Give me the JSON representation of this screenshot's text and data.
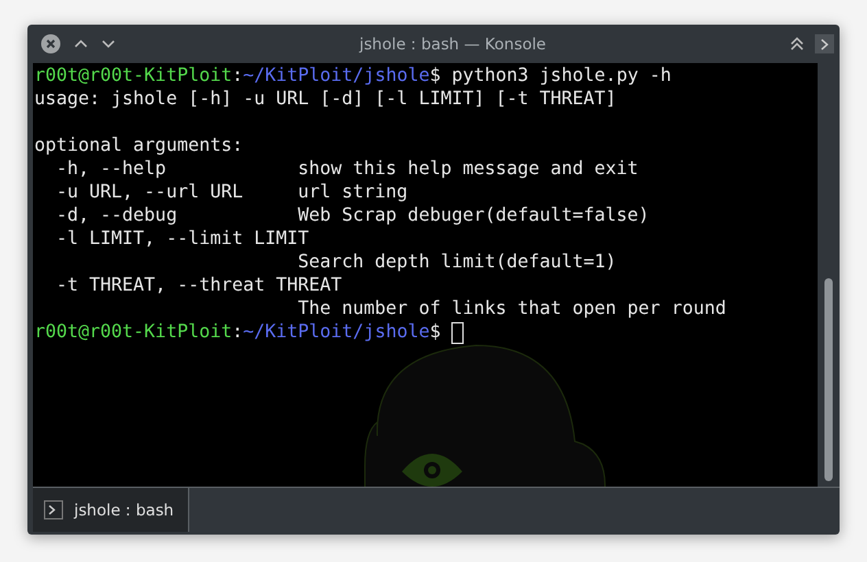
{
  "window": {
    "title": "jshole : bash — Konsole"
  },
  "terminal": {
    "lines": [
      {
        "kind": "prompt",
        "segments": [
          {
            "kind": "user",
            "text": "r00t@r00t-KitPloit"
          },
          {
            "kind": "plain",
            "text": ":"
          },
          {
            "kind": "path",
            "text": "~/KitPloit/jshole"
          },
          {
            "kind": "plain",
            "text": "$ "
          },
          {
            "kind": "command",
            "text": "python3 jshole.py -h"
          }
        ]
      },
      {
        "kind": "output",
        "text": "usage: jshole [-h] -u URL [-d] [-l LIMIT] [-t THREAT]"
      },
      {
        "kind": "blank"
      },
      {
        "kind": "output",
        "text": "optional arguments:"
      },
      {
        "kind": "output",
        "text": "  -h, --help            show this help message and exit"
      },
      {
        "kind": "output",
        "text": "  -u URL, --url URL     url string"
      },
      {
        "kind": "output",
        "text": "  -d, --debug           Web Scrap debuger(default=false)"
      },
      {
        "kind": "output",
        "text": "  -l LIMIT, --limit LIMIT"
      },
      {
        "kind": "output",
        "text": "                        Search depth limit(default=1)"
      },
      {
        "kind": "output",
        "text": "  -t THREAT, --threat THREAT"
      },
      {
        "kind": "output",
        "text": "                        The number of links that open per round"
      },
      {
        "kind": "prompt",
        "cursor": true,
        "segments": [
          {
            "kind": "user",
            "text": "r00t@r00t-KitPloit"
          },
          {
            "kind": "plain",
            "text": ":"
          },
          {
            "kind": "path",
            "text": "~/KitPloit/jshole"
          },
          {
            "kind": "plain",
            "text": "$ "
          }
        ]
      }
    ]
  },
  "tabs": [
    {
      "label": "jshole : bash",
      "selected": true
    }
  ]
}
